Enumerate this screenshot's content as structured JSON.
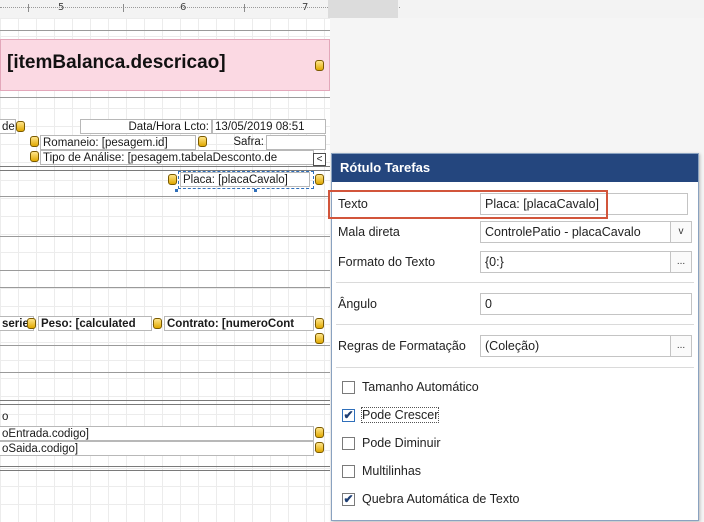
{
  "ruler": {
    "numbers": [
      "5",
      "6",
      "7"
    ]
  },
  "report": {
    "title_field": "[itemBalanca.descricao]",
    "fields": {
      "left_fragment_1": "de",
      "data_hora_label": "Data/Hora Lcto:",
      "data_hora_value": "13/05/2019 08:51",
      "romaneio": "Romaneio: [pesagem.id]",
      "safra": "Safra:",
      "tipo_analise": "Tipo de Análise: [pesagem.tabelaDesconto.de",
      "placa": "Placa: [placaCavalo]",
      "serie_fragment": "serie",
      "peso": "Peso: [calculated",
      "contrato": "Contrato: [numeroCont",
      "o_fragment": "o",
      "entrada": "oEntrada.codigo]",
      "saida": "oSaida.codigo]"
    },
    "smart_tag": "<"
  },
  "panel": {
    "title": "Rótulo Tarefas",
    "rows": {
      "texto": {
        "label": "Texto",
        "value": "Placa: [placaCavalo]"
      },
      "mala_direta": {
        "label": "Mala direta",
        "value": "ControlePatio - placaCavalo"
      },
      "formato": {
        "label": "Formato do Texto",
        "value": "{0:}"
      },
      "angulo": {
        "label": "Ângulo",
        "value": "0"
      },
      "regras": {
        "label": "Regras de Formatação",
        "value": "(Coleção)"
      }
    },
    "ellipsis": "...",
    "dropdown_glyph": "v",
    "checkboxes": [
      {
        "label": "Tamanho Automático",
        "checked": false
      },
      {
        "label": "Pode Crescer",
        "checked": true
      },
      {
        "label": "Pode Diminuir",
        "checked": false
      },
      {
        "label": "Multilinhas",
        "checked": false
      },
      {
        "label": "Quebra Automática de Texto",
        "checked": true
      }
    ],
    "check_glyph": "✔"
  }
}
